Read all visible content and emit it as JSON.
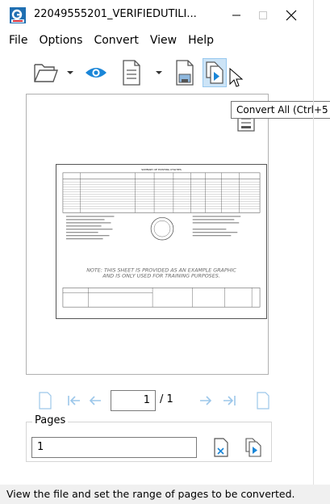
{
  "window": {
    "title": "22049555201_VERIFIEDUTILI...",
    "minimize_icon": "minimize-icon",
    "maximize_icon": "maximize-icon",
    "close_icon": "close-icon"
  },
  "menu": {
    "items": [
      "File",
      "Options",
      "Convert",
      "View",
      "Help"
    ]
  },
  "toolbar": {
    "tools": [
      {
        "name": "open-folder",
        "icon": "folder-icon"
      },
      {
        "name": "open-dropdown",
        "icon": "chevron-down-icon"
      },
      {
        "name": "preview",
        "icon": "eye-icon"
      },
      {
        "name": "document",
        "icon": "document-icon"
      },
      {
        "name": "document-dropdown",
        "icon": "chevron-down-icon"
      },
      {
        "name": "save",
        "icon": "save-icon"
      },
      {
        "name": "convert-all",
        "icon": "convert-all-icon"
      }
    ],
    "tooltip": "Convert All (Ctrl+5"
  },
  "preview": {
    "sheet_heading": "SUMMARY OF EXISTING UTILITIES",
    "note_line1": "NOTE: THIS SHEET IS PROVIDED AS AN EXAMPLE GRAPHIC",
    "note_line2": "AND IS ONLY USED FOR TRAINING PURPOSES."
  },
  "navigation": {
    "current_page": "1",
    "total_pages": "/ 1"
  },
  "pages": {
    "label": "Pages",
    "value": "1"
  },
  "status": {
    "text": "View the file and set the range of pages to be converted."
  },
  "colors": {
    "accent": "#1a86d8",
    "disabled": "#9cc7ea",
    "pressed_bg": "#cce4f7"
  }
}
